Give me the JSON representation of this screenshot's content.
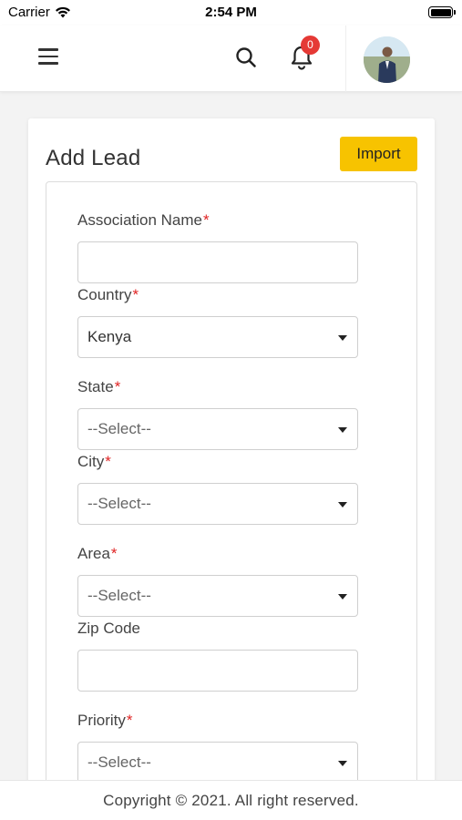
{
  "status_bar": {
    "carrier": "Carrier",
    "time": "2:54 PM"
  },
  "header": {
    "icons": [
      "menu-icon",
      "search-icon",
      "bell-icon"
    ],
    "notification_count": "0"
  },
  "page": {
    "title": "Add Lead",
    "import_label": "Import"
  },
  "form": {
    "association_name": {
      "label": "Association Name",
      "value": "",
      "required": "*"
    },
    "country": {
      "label": "Country",
      "value": "Kenya",
      "required": "*"
    },
    "state": {
      "label": "State",
      "value": "--Select--",
      "required": "*"
    },
    "city": {
      "label": "City",
      "value": "--Select--",
      "required": "*"
    },
    "area": {
      "label": "Area",
      "value": "--Select--",
      "required": "*"
    },
    "zip_code": {
      "label": "Zip Code",
      "value": ""
    },
    "priority": {
      "label": "Priority",
      "value": "--Select--",
      "required": "*"
    }
  },
  "footer": {
    "copyright": "Copyright © 2021. All right reserved."
  },
  "colors": {
    "accent": "#f7c300",
    "badge": "#e53935",
    "required": "#e02424"
  }
}
